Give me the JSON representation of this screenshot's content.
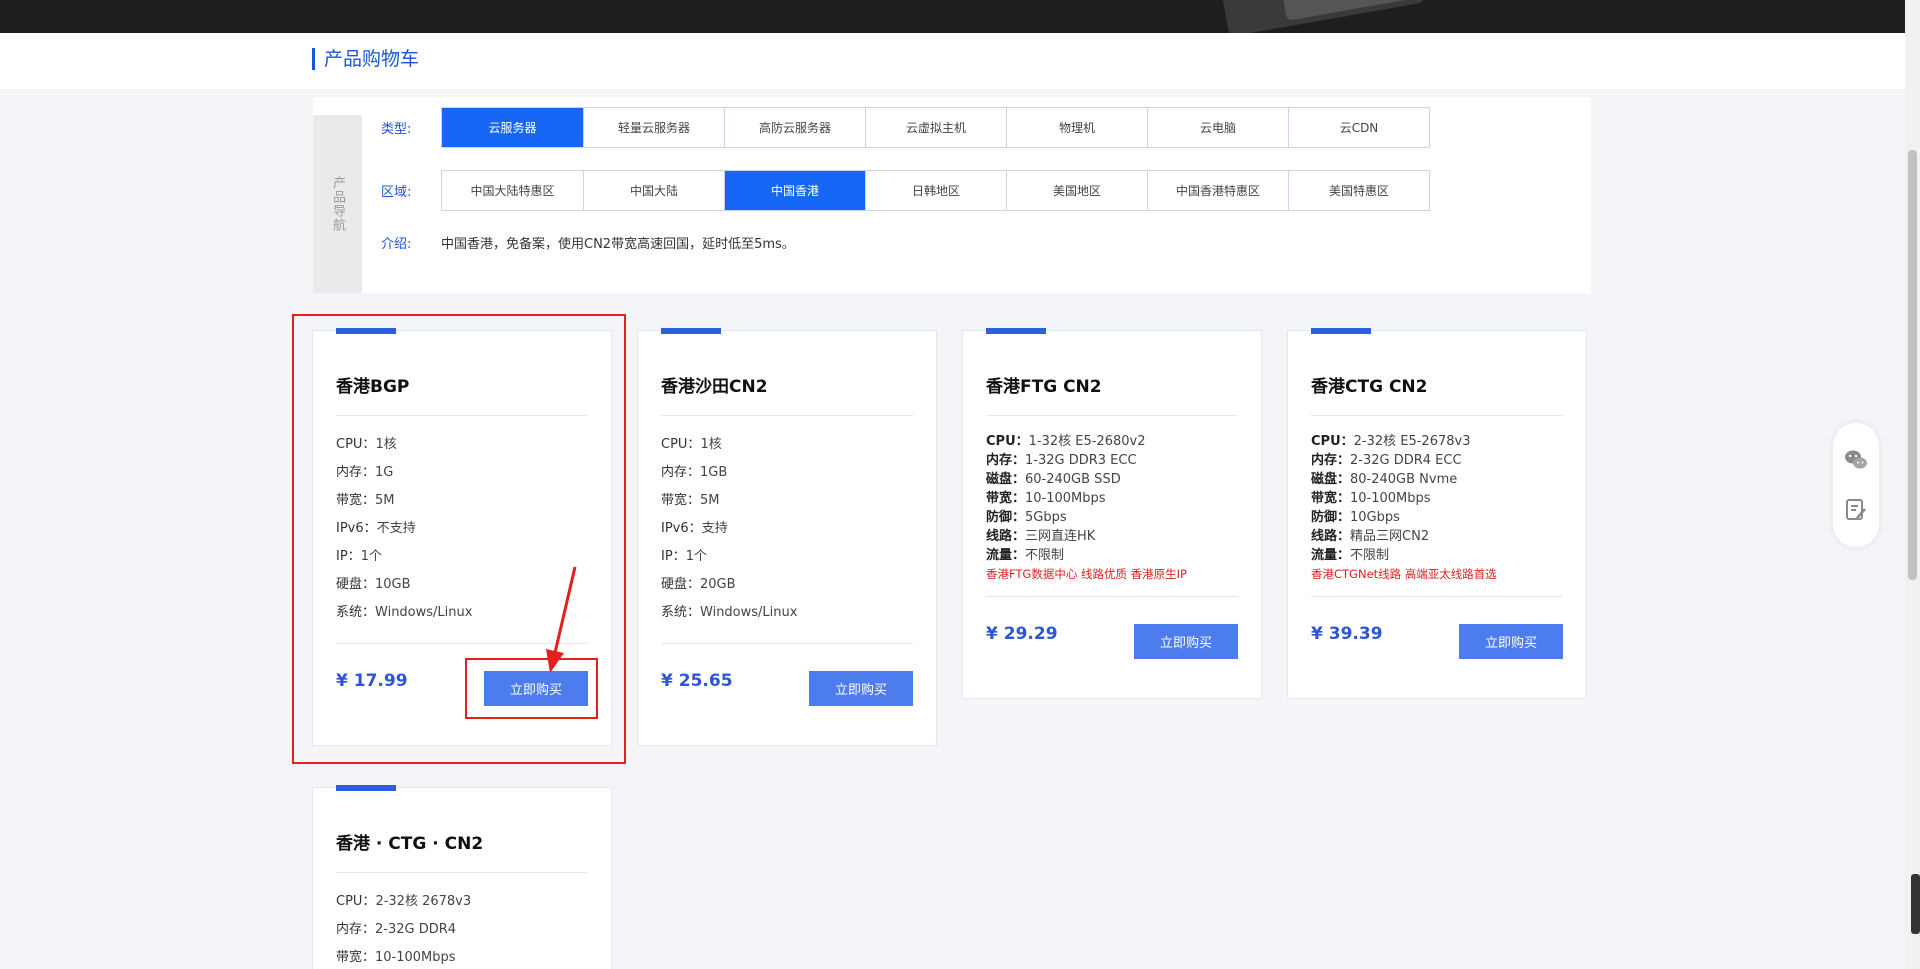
{
  "page": {
    "title": "产品购物车"
  },
  "nav": {
    "side_label": "产品导航",
    "type": {
      "label": "类型:",
      "options": [
        "云服务器",
        "轻量云服务器",
        "高防云服务器",
        "云虚拟主机",
        "物理机",
        "云电脑",
        "云CDN"
      ],
      "active": "云服务器"
    },
    "region": {
      "label": "区域:",
      "options": [
        "中国大陆特惠区",
        "中国大陆",
        "中国香港",
        "日韩地区",
        "美国地区",
        "中国香港特惠区",
        "美国特惠区"
      ],
      "active": "中国香港"
    },
    "intro": {
      "label": "介绍:",
      "text": "中国香港，免备案，使用CN2带宽高速回国，延时低至5ms。"
    }
  },
  "products": [
    {
      "name": "香港BGP",
      "specs": [
        {
          "k": "CPU：",
          "v": "1核"
        },
        {
          "k": "内存：",
          "v": "1G"
        },
        {
          "k": "带宽：",
          "v": "5M"
        },
        {
          "k": "IPv6：",
          "v": "不支持"
        },
        {
          "k": "IP：",
          "v": "1个"
        },
        {
          "k": "硬盘：",
          "v": "10GB"
        },
        {
          "k": "系统：",
          "v": "Windows/Linux"
        }
      ],
      "price": "¥ 17.99",
      "buy_label": "立即购买"
    },
    {
      "name": "香港沙田CN2",
      "specs": [
        {
          "k": "CPU：",
          "v": "1核"
        },
        {
          "k": "内存：",
          "v": "1GB"
        },
        {
          "k": "带宽：",
          "v": "5M"
        },
        {
          "k": "IPv6：",
          "v": "支持"
        },
        {
          "k": "IP：",
          "v": "1个"
        },
        {
          "k": "硬盘：",
          "v": "20GB"
        },
        {
          "k": "系统：",
          "v": "Windows/Linux"
        }
      ],
      "price": "¥ 25.65",
      "buy_label": "立即购买"
    },
    {
      "name": "香港FTG CN2",
      "specs": [
        {
          "k": "CPU：",
          "v": "1-32核 E5-2680v2"
        },
        {
          "k": "内存：",
          "v": "1-32G DDR3 ECC"
        },
        {
          "k": "磁盘：",
          "v": "60-240GB SSD"
        },
        {
          "k": "带宽：",
          "v": "10-100Mbps"
        },
        {
          "k": "防御：",
          "v": "5Gbps"
        },
        {
          "k": "线路：",
          "v": "三网直连HK"
        },
        {
          "k": "流量：",
          "v": "不限制"
        }
      ],
      "promo": "香港FTG数据中心 线路优质 香港原生IP",
      "price": "¥ 29.29",
      "buy_label": "立即购买"
    },
    {
      "name": "香港CTG CN2",
      "specs": [
        {
          "k": "CPU：",
          "v": "2-32核 E5-2678v3"
        },
        {
          "k": "内存：",
          "v": "2-32G DDR4 ECC"
        },
        {
          "k": "磁盘：",
          "v": "80-240GB Nvme"
        },
        {
          "k": "带宽：",
          "v": "10-100Mbps"
        },
        {
          "k": "防御：",
          "v": "10Gbps"
        },
        {
          "k": "线路：",
          "v": "精品三网CN2"
        },
        {
          "k": "流量：",
          "v": "不限制"
        }
      ],
      "promo": "香港CTGNet线路 高端亚太线路首选",
      "price": "¥ 39.39",
      "buy_label": "立即购买"
    },
    {
      "name": "香港 · CTG · CN2",
      "specs": [
        {
          "k": "CPU：",
          "v": "2-32核 2678v3"
        },
        {
          "k": "内存：",
          "v": "2-32G DDR4"
        },
        {
          "k": "带宽：",
          "v": "10-100Mbps"
        }
      ]
    }
  ],
  "float_tools": {
    "icons": [
      "wechat-icon",
      "edit-note-icon"
    ]
  },
  "colors": {
    "accent": "#1667f6",
    "price": "#2d56d6",
    "highlight": "#e3201b"
  }
}
